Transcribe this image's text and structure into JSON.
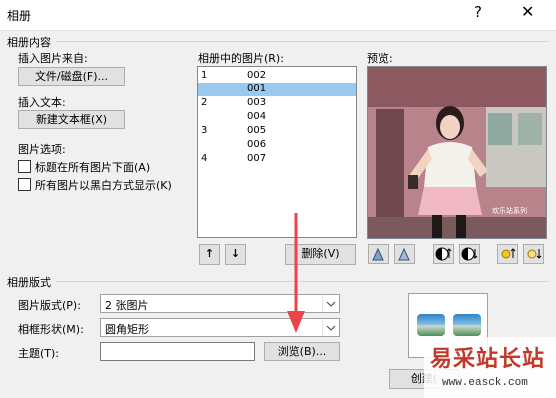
{
  "window": {
    "title": "相册",
    "help": "?",
    "close": "✕"
  },
  "content_group": {
    "label": "相册内容"
  },
  "insert_picture": {
    "label": "插入图片来自:",
    "button": "文件/磁盘(F)..."
  },
  "insert_text": {
    "label": "插入文本:",
    "button": "新建文本框(X)"
  },
  "picture_options": {
    "label": "图片选项:",
    "captions": {
      "label": "标题在所有图片下面(A)",
      "checked": false
    },
    "black_white": {
      "label": "所有图片以黑白方式显示(K)",
      "checked": false
    }
  },
  "pictures_list": {
    "label": "相册中的图片(R):",
    "items": [
      {
        "num": "1",
        "name": "002",
        "selected": false
      },
      {
        "num": "",
        "name": "001",
        "selected": true
      },
      {
        "num": "2",
        "name": "003",
        "selected": false
      },
      {
        "num": "",
        "name": "004",
        "selected": false
      },
      {
        "num": "3",
        "name": "005",
        "selected": false
      },
      {
        "num": "",
        "name": "006",
        "selected": false
      },
      {
        "num": "4",
        "name": "007",
        "selected": false
      }
    ],
    "move_up": "↑",
    "move_down": "↓",
    "delete_button": "删除(V)"
  },
  "preview": {
    "label": "预览:",
    "photo_caption": "欢乐站系列"
  },
  "layout_group": {
    "label": "相册版式"
  },
  "picture_layout": {
    "label": "图片版式(P):",
    "value": "2 张图片"
  },
  "frame_shape": {
    "label": "相框形状(M):",
    "value": "圆角矩形"
  },
  "theme": {
    "label": "主题(T):",
    "value": "",
    "browse_button": "浏览(B)..."
  },
  "create_button": "创建(",
  "watermark": {
    "text": "易采站长站",
    "url": "www.easck.com"
  },
  "colors": {
    "selection": "#99c9ef",
    "arrow": "#e8454a",
    "face": "#f0f0f0"
  }
}
